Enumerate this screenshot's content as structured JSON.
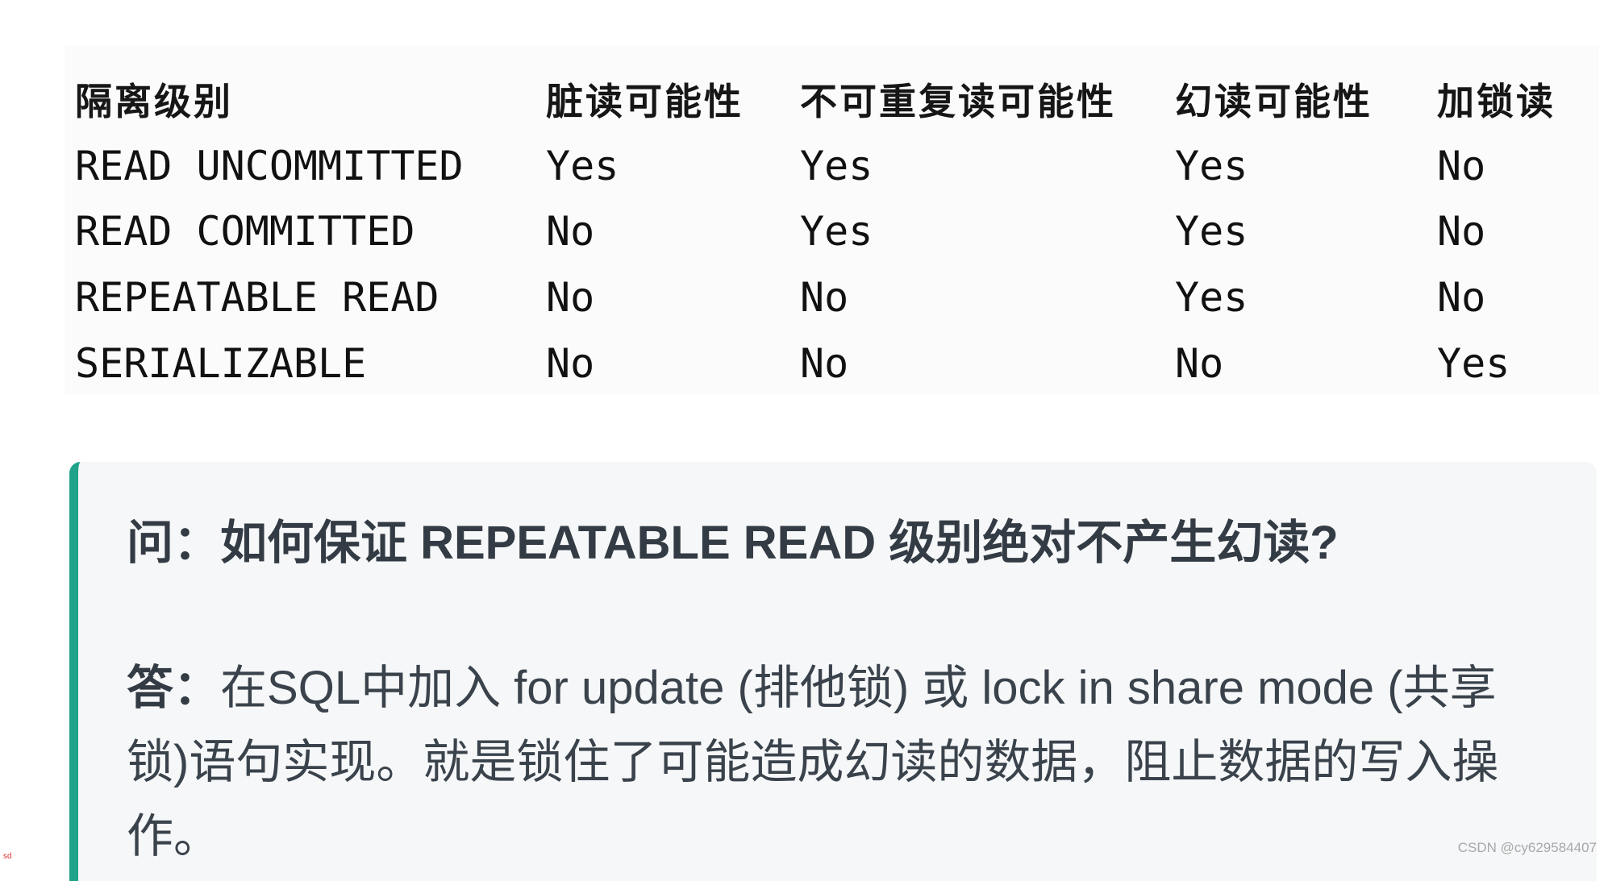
{
  "table": {
    "headers": [
      "隔离级别",
      "脏读可能性",
      "不可重复读可能性",
      "幻读可能性",
      "加锁读"
    ],
    "rows": [
      [
        "READ UNCOMMITTED",
        "Yes",
        "Yes",
        "Yes",
        "No"
      ],
      [
        "READ COMMITTED",
        "No",
        "Yes",
        "Yes",
        "No"
      ],
      [
        "REPEATABLE READ",
        "No",
        "No",
        "Yes",
        "No"
      ],
      [
        "SERIALIZABLE",
        "No",
        "No",
        "No",
        "Yes"
      ]
    ]
  },
  "blockquote": {
    "accent_color": "#1fa38a",
    "question": "问：如何保证 REPEATABLE READ 级别绝对不产生幻读?",
    "answer_prefix": "答：",
    "answer_line1": "在SQL中加入 for update (排他锁) 或 lock in share mode (共享",
    "answer_line2": "锁)语句实现。就是锁住了可能造成幻读的数据，阻止数据的写入操",
    "answer_line3": "作。"
  },
  "watermark": "CSDN @cy629584407",
  "corner_mark": "sd"
}
